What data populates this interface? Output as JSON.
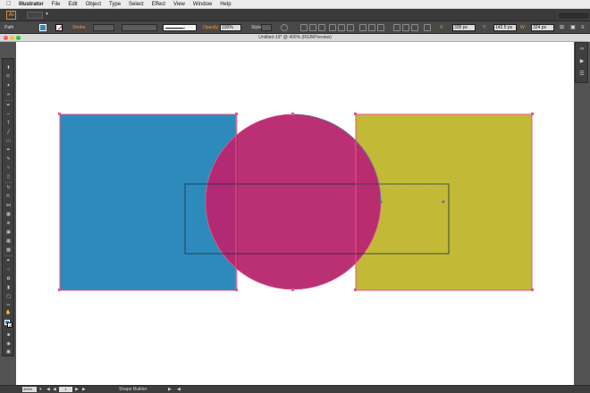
{
  "menubar": {
    "app_name": "Illustrator",
    "items": [
      "File",
      "Edit",
      "Object",
      "Type",
      "Select",
      "Effect",
      "View",
      "Window",
      "Help"
    ]
  },
  "appbar": {
    "logo": "Ai"
  },
  "control": {
    "selection_label": "Path",
    "stroke_label": "Stroke",
    "stroke_style": "Basic",
    "opacity_label": "Opacity:",
    "opacity_value": "100%",
    "style_label": "Style:",
    "x_label": "X:",
    "x_value": "339 px",
    "y_label": "Y:",
    "y_value": "142.5 px",
    "w_label": "W:",
    "w_value": "324 px"
  },
  "document": {
    "title": "Untitled-19* @ 400% (RGB/Preview)"
  },
  "status": {
    "zoom": "400%",
    "page": "1",
    "tool": "Shape Builder"
  },
  "colors": {
    "blue_square": "#2d8bbc",
    "magenta_circle": "#b8266f",
    "olive_square": "#c2b936",
    "anchor_highlight": "#e0588a"
  },
  "tools": [
    "selection-icon",
    "direct-selection-icon",
    "magic-wand-icon",
    "lasso-icon",
    "pen-icon",
    "curvature-icon",
    "type-icon",
    "line-segment-icon",
    "rectangle-icon",
    "paintbrush-icon",
    "pencil-icon",
    "shaper-icon",
    "eraser-icon",
    "rotate-icon",
    "scale-icon",
    "width-icon",
    "free-transform-icon",
    "shape-builder-icon",
    "perspective-icon",
    "mesh-icon",
    "gradient-icon",
    "eyedropper-icon",
    "blend-icon",
    "symbol-sprayer-icon",
    "column-graph-icon",
    "artboard-icon",
    "slice-icon",
    "hand-icon",
    "zoom-icon"
  ],
  "dock": [
    "cc-libraries-icon",
    "actions-icon",
    "layers-icon"
  ]
}
